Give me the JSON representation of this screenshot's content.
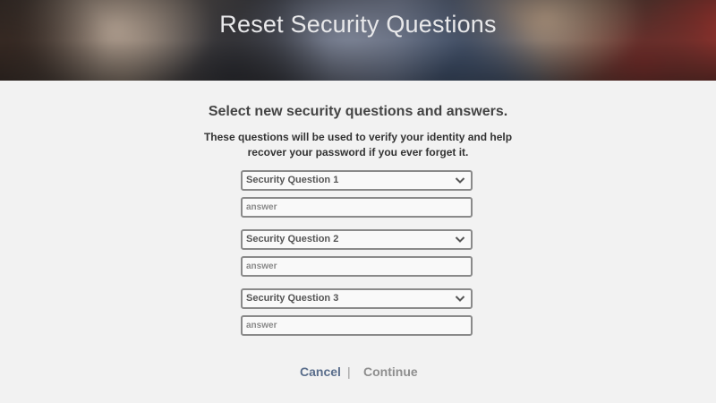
{
  "header": {
    "title": "Reset Security Questions"
  },
  "main": {
    "headline": "Select new security questions and answers.",
    "description": "These questions will be used to verify your identity and help recover your password if you ever forget it.",
    "questions": [
      {
        "select_label": "Security Question 1",
        "answer_placeholder": "answer"
      },
      {
        "select_label": "Security Question 2",
        "answer_placeholder": "answer"
      },
      {
        "select_label": "Security Question 3",
        "answer_placeholder": "answer"
      }
    ]
  },
  "actions": {
    "cancel_label": "Cancel",
    "separator": "|",
    "continue_label": "Continue"
  },
  "icons": {
    "dropdown": "chevron-down-icon"
  },
  "colors": {
    "cancel": "#5a6e8c",
    "continue_disabled": "#8e8e8e"
  }
}
